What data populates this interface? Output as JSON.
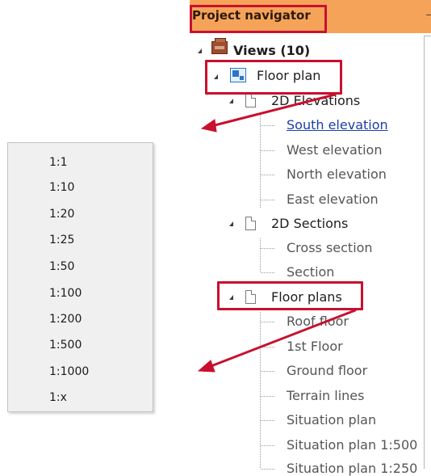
{
  "scale_menu": {
    "options": [
      "1:1",
      "1:10",
      "1:20",
      "1:25",
      "1:50",
      "1:100",
      "1:200",
      "1:500",
      "1:1000",
      "1:x"
    ]
  },
  "navigator": {
    "title": "Project navigator",
    "pin_icon": "pin-icon",
    "views": "Views (10)",
    "floor_plan": "Floor plan",
    "elevations_group": "2D Elevations",
    "elevations": [
      "South elevation",
      "West elevation",
      "North elevation",
      "East elevation"
    ],
    "sections_group": "2D Sections",
    "sections": [
      "Cross section",
      "Section"
    ],
    "floor_plans_group": "Floor plans",
    "floor_plans": [
      "Roof floor",
      "1st Floor",
      "Ground floor",
      "Terrain lines",
      "Situation plan",
      "Situation plan 1:500",
      "Situation plan 1:250"
    ]
  },
  "colors": {
    "title_bar": "#f6a35a",
    "annotation_red": "#c8102e",
    "link_blue": "#1b3fa6"
  }
}
